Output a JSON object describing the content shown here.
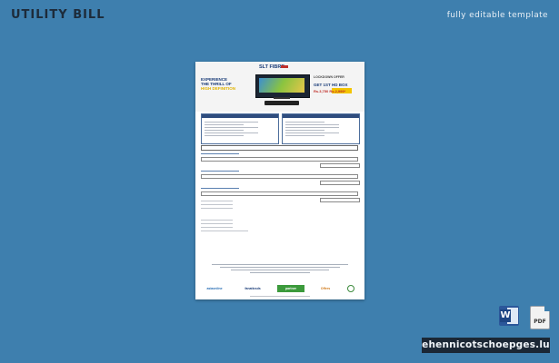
{
  "header": {
    "title": "UTILITY BILL",
    "subtitle": "fully editable template"
  },
  "bill": {
    "brand": "SLT FIBRE",
    "slogan_line1": "EXPERIENCE",
    "slogan_line2": "THE THRILL OF",
    "slogan_highlight": "HIGH DEFINITION",
    "offer_label": "LOCKDOWN OFFER",
    "offer_title": "GET 1ST HD BOX",
    "offer_price": "Rs.3,750 Rs.2,999*"
  },
  "partner_logos": [
    {
      "name": "asiaonline",
      "color": "#2a6fb5"
    },
    {
      "name": "fanaticsds",
      "color": "#1a3c78"
    },
    {
      "name": "partner",
      "color": "#3c9a3c"
    },
    {
      "name": "Offers",
      "color": "#d07a1a"
    },
    {
      "name": "seal",
      "color": "#3c8a3c"
    }
  ],
  "file_formats": {
    "word": "W",
    "pdf": "PDF"
  },
  "watermark": "ehennicotschoepges.lu"
}
